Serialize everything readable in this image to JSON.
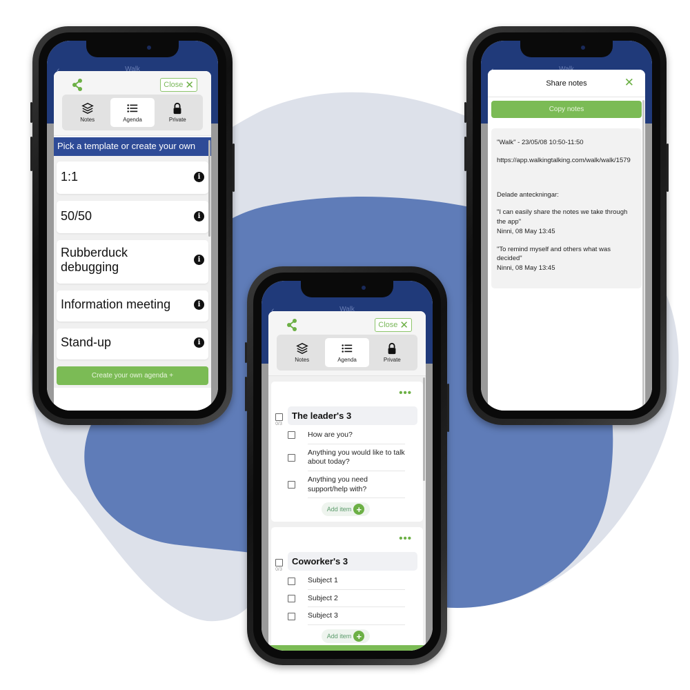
{
  "colors": {
    "brand_blue": "#2e4b97",
    "header_blue": "#203a7a",
    "accent_green": "#7bbb55",
    "bg_light": "#dde1ea",
    "bg_blob": "#5f7cb8"
  },
  "phone_left": {
    "header_title": "Walk",
    "close_label": "Close",
    "tabs": [
      {
        "label": "Notes",
        "icon": "layers-icon",
        "active": false
      },
      {
        "label": "Agenda",
        "icon": "list-icon",
        "active": true
      },
      {
        "label": "Private",
        "icon": "lock-icon",
        "active": false
      }
    ],
    "banner": "Pick a template or create your own",
    "templates": [
      {
        "label": "1:1",
        "icon": "info-icon"
      },
      {
        "label": "50/50",
        "icon": "info-icon"
      },
      {
        "label": "Rubberduck debugging",
        "icon": "info-icon"
      },
      {
        "label": "Information meeting",
        "icon": "info-icon"
      },
      {
        "label": "Stand-up",
        "icon": "info-icon"
      }
    ],
    "create_label": "Create your own agenda +"
  },
  "phone_center": {
    "header_title": "Walk",
    "close_label": "Close",
    "tabs": [
      {
        "label": "Notes",
        "icon": "layers-icon",
        "active": false
      },
      {
        "label": "Agenda",
        "icon": "list-icon",
        "active": true
      },
      {
        "label": "Private",
        "icon": "lock-icon",
        "active": false
      }
    ],
    "agendas": [
      {
        "title": "The leader's 3",
        "progress": "0/3",
        "items": [
          "How are you?",
          "Anything you would like to talk about today?",
          "Anything you need support/help with?"
        ],
        "add_label": "Add item"
      },
      {
        "title": "Coworker's 3",
        "progress": "0/3",
        "items": [
          "Subject 1",
          "Subject 2",
          "Subject 3"
        ],
        "add_label": "Add item"
      }
    ]
  },
  "phone_right": {
    "header_title": "Walk",
    "title": "Share notes",
    "copy_label": "Copy notes",
    "notes": {
      "walk_line": "\"Walk\" - 23/05/08 10:50-11:50",
      "url_line": "https://app.walkingtalking.com/walk/walk/1579",
      "shared_heading": "Delade anteckningar:",
      "entries": [
        {
          "quote": "\"I can easily share the notes we take through the app\"",
          "author": "Ninni, 08 May 13:45"
        },
        {
          "quote": "\"To remind myself and others what was decided\"",
          "author": "Ninni, 08 May 13:45"
        }
      ]
    }
  }
}
